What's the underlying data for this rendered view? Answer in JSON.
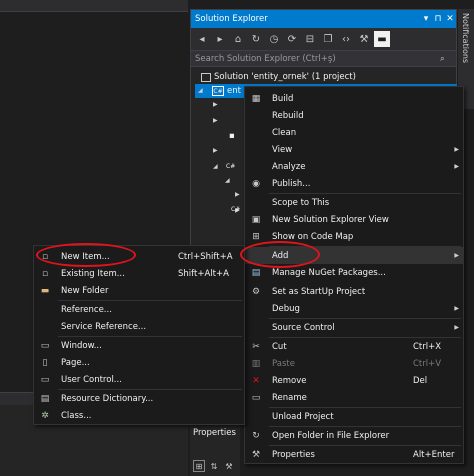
{
  "solution_explorer": {
    "title": "Solution Explorer",
    "title_controls": [
      "▾",
      "⊓",
      "✕"
    ],
    "search_placeholder": "Search Solution Explorer (Ctrl+ş)",
    "solution_label": "Solution 'entity_ornek' (1 project)",
    "project_label": "ent",
    "partial_items": [
      "C#",
      "C#"
    ]
  },
  "notifications_label": "Notifications",
  "properties_label": "Properties",
  "context_menu": {
    "items": [
      {
        "label": "Build",
        "icon": "build-icon",
        "glyph": "▦"
      },
      {
        "label": "Rebuild"
      },
      {
        "label": "Clean"
      },
      {
        "label": "View",
        "submenu": true
      },
      {
        "label": "Analyze",
        "submenu": true
      },
      {
        "label": "Publish...",
        "icon": "globe-icon",
        "glyph": "◉"
      },
      {
        "label": "Scope to This"
      },
      {
        "label": "New Solution Explorer View",
        "icon": "new-view-icon",
        "glyph": "▣"
      },
      {
        "label": "Show on Code Map",
        "icon": "code-map-icon",
        "glyph": "⊞"
      },
      {
        "label": "Add",
        "submenu": true
      },
      {
        "label": "Manage NuGet Packages...",
        "icon": "nuget-icon",
        "glyph": "▤"
      },
      {
        "label": "Set as StartUp Project",
        "icon": "gear-icon",
        "glyph": "⚙"
      },
      {
        "label": "Debug",
        "submenu": true
      },
      {
        "label": "Source Control",
        "submenu": true
      },
      {
        "label": "Cut",
        "shortcut": "Ctrl+X",
        "icon": "cut-icon",
        "glyph": "✂"
      },
      {
        "label": "Paste",
        "shortcut": "Ctrl+V",
        "icon": "paste-icon",
        "glyph": "▥"
      },
      {
        "label": "Remove",
        "shortcut": "Del",
        "icon": "remove-icon",
        "glyph": "✕"
      },
      {
        "label": "Rename",
        "icon": "rename-icon",
        "glyph": "▭"
      },
      {
        "label": "Unload Project"
      },
      {
        "label": "Open Folder in File Explorer",
        "icon": "open-folder-icon",
        "glyph": "↻"
      },
      {
        "label": "Properties",
        "shortcut": "Alt+Enter",
        "icon": "wrench-icon",
        "glyph": "⚒"
      }
    ]
  },
  "add_submenu": {
    "items": [
      {
        "label": "New Item...",
        "shortcut": "Ctrl+Shift+A",
        "icon": "new-item-icon",
        "glyph": "▫"
      },
      {
        "label": "Existing Item...",
        "shortcut": "Shift+Alt+A",
        "icon": "existing-item-icon",
        "glyph": "▫"
      },
      {
        "label": "New Folder",
        "icon": "folder-icon",
        "glyph": "▬"
      },
      {
        "label": "Reference..."
      },
      {
        "label": "Service Reference..."
      },
      {
        "label": "Window...",
        "icon": "window-icon",
        "glyph": "▭"
      },
      {
        "label": "Page...",
        "icon": "page-icon",
        "glyph": "▯"
      },
      {
        "label": "User Control...",
        "icon": "user-control-icon",
        "glyph": "▭"
      },
      {
        "label": "Resource Dictionary...",
        "icon": "resource-dictionary-icon",
        "glyph": "▤"
      },
      {
        "label": "Class...",
        "icon": "class-icon",
        "glyph": "✲"
      }
    ]
  },
  "colors": {
    "accent": "#007acc",
    "highlight_ring": "#e0141b",
    "menu_bg": "#1b1b1c",
    "disabled_text": "#7a7a7a"
  }
}
